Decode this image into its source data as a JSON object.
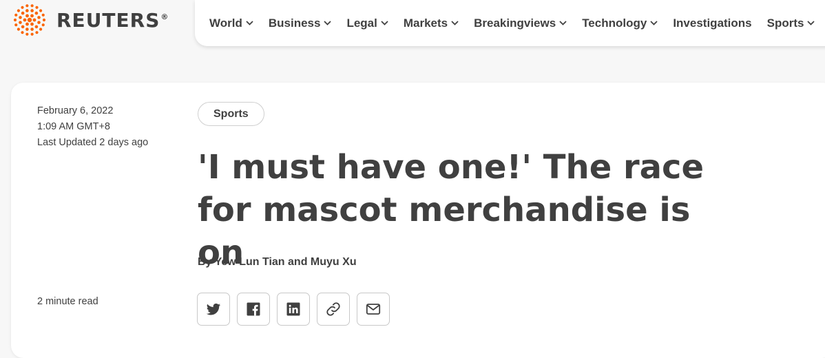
{
  "brand": {
    "name": "REUTERS",
    "registered": "®",
    "accent": "#fa6400"
  },
  "nav": {
    "items": [
      {
        "label": "World",
        "dropdown": true
      },
      {
        "label": "Business",
        "dropdown": true
      },
      {
        "label": "Legal",
        "dropdown": true
      },
      {
        "label": "Markets",
        "dropdown": true
      },
      {
        "label": "Breakingviews",
        "dropdown": true
      },
      {
        "label": "Technology",
        "dropdown": true
      },
      {
        "label": "Investigations",
        "dropdown": false
      },
      {
        "label": "Sports",
        "dropdown": true
      }
    ]
  },
  "article": {
    "date": "February 6, 2022",
    "time": "1:09 AM GMT+8",
    "updated": "Last Updated 2 days ago",
    "section": "Sports",
    "headline": "'I must have one!' The race for mascot merchandise is on",
    "byline_prefix": "By",
    "authors": [
      "Yew Lun Tian",
      "Muyu Xu"
    ],
    "byline_joiner": "and",
    "read_time": "2 minute read"
  },
  "share": {
    "icons": [
      "twitter-icon",
      "facebook-icon",
      "linkedin-icon",
      "link-icon",
      "email-icon"
    ]
  },
  "colors": {
    "text": "#404040",
    "page_bg": "#f7f7f7",
    "card_bg": "#ffffff",
    "border": "#c8c8c8"
  }
}
